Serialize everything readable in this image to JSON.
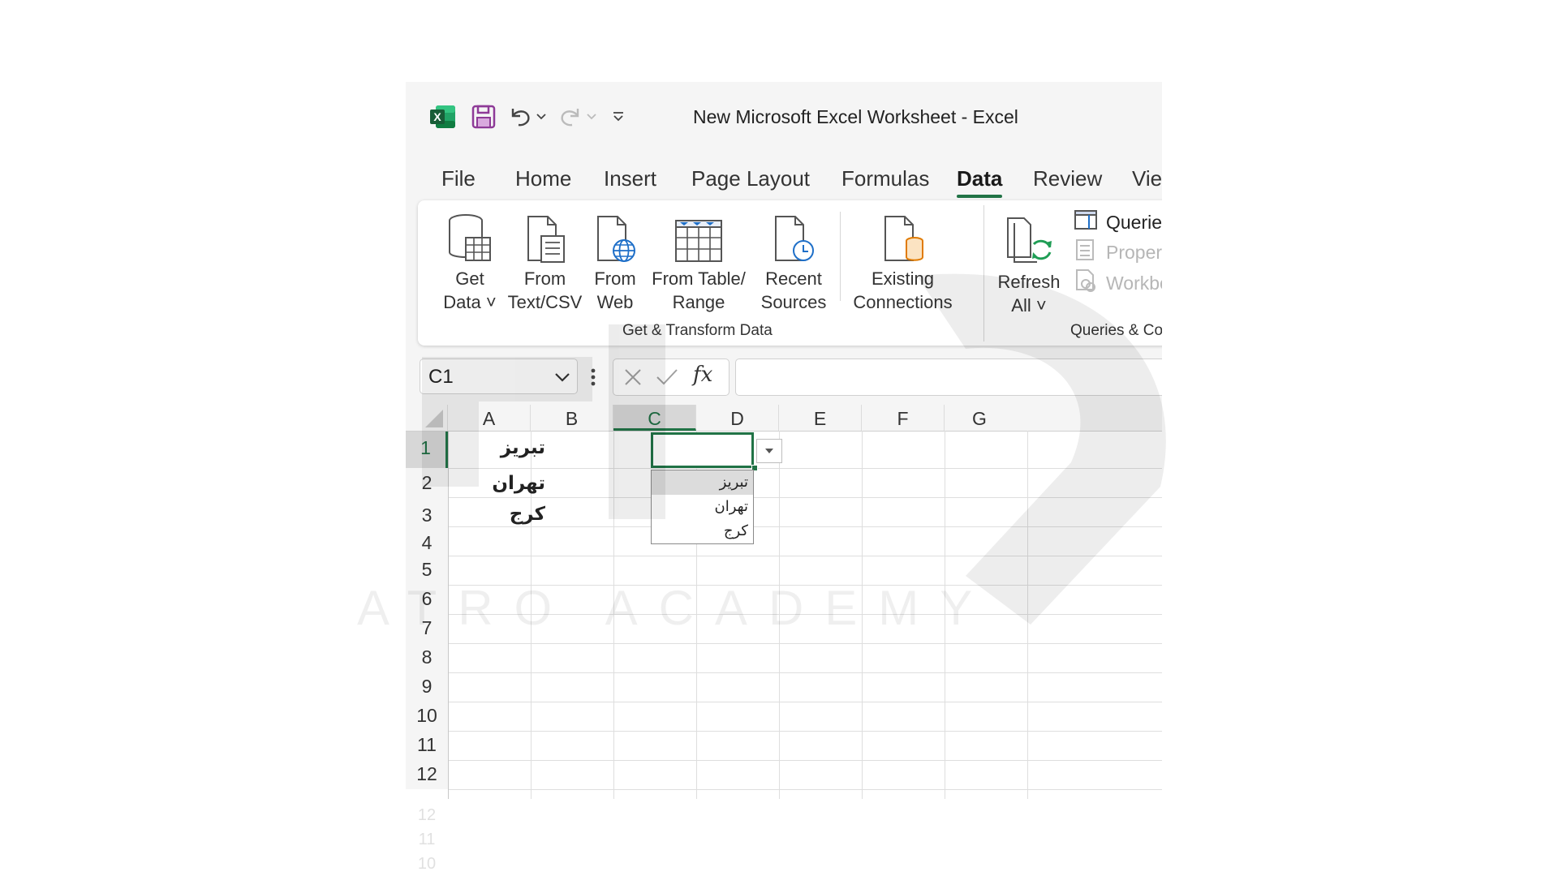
{
  "window": {
    "title": "New Microsoft Excel Worksheet  -  Excel"
  },
  "tabs": [
    "File",
    "Home",
    "Insert",
    "Page Layout",
    "Formulas",
    "Data",
    "Review",
    "Viev"
  ],
  "active_tab": "Data",
  "ribbon": {
    "get_transform": {
      "label": "Get & Transform Data",
      "buttons": [
        {
          "line1": "Get",
          "line2": "Data ˅",
          "icon": "database-table-icon"
        },
        {
          "line1": "From",
          "line2": "Text/CSV",
          "icon": "text-file-icon"
        },
        {
          "line1": "From",
          "line2": "Web",
          "icon": "web-page-icon"
        },
        {
          "line1": "From Table/",
          "line2": "Range",
          "icon": "table-range-icon"
        },
        {
          "line1": "Recent",
          "line2": "Sources",
          "icon": "recent-sources-icon"
        },
        {
          "line1": "Existing",
          "line2": "Connections",
          "icon": "existing-connections-icon"
        }
      ]
    },
    "queries": {
      "label": "Queries & Co",
      "refresh": {
        "line1": "Refresh",
        "line2": "All ˅",
        "icon": "refresh-all-icon"
      },
      "small": [
        {
          "label": "Queries",
          "icon": "queries-pane-icon",
          "enabled": true
        },
        {
          "label": "Propert",
          "icon": "properties-icon",
          "enabled": false
        },
        {
          "label": "Workbo",
          "icon": "workbook-links-icon",
          "enabled": false
        }
      ]
    }
  },
  "formula_bar": {
    "name_box": "C1",
    "fx": "fx",
    "value": ""
  },
  "columns": [
    "A",
    "B",
    "C",
    "D",
    "E",
    "F",
    "G"
  ],
  "rows": [
    "1",
    "2",
    "3",
    "4",
    "5",
    "6",
    "7",
    "8",
    "9",
    "10",
    "11",
    "12"
  ],
  "cells": {
    "A1": "تبریز",
    "A2": "تهران",
    "A3": "کرج"
  },
  "selected_cell": "C1",
  "dropdown": {
    "options": [
      "تبریز",
      "تهران",
      "کرج"
    ],
    "highlighted": 0
  },
  "watermark": {
    "text": "ATRO ACADEMY"
  },
  "colors": {
    "accent": "#217346",
    "excel_green": "#1d6f42",
    "save_purple": "#8e3a97"
  }
}
